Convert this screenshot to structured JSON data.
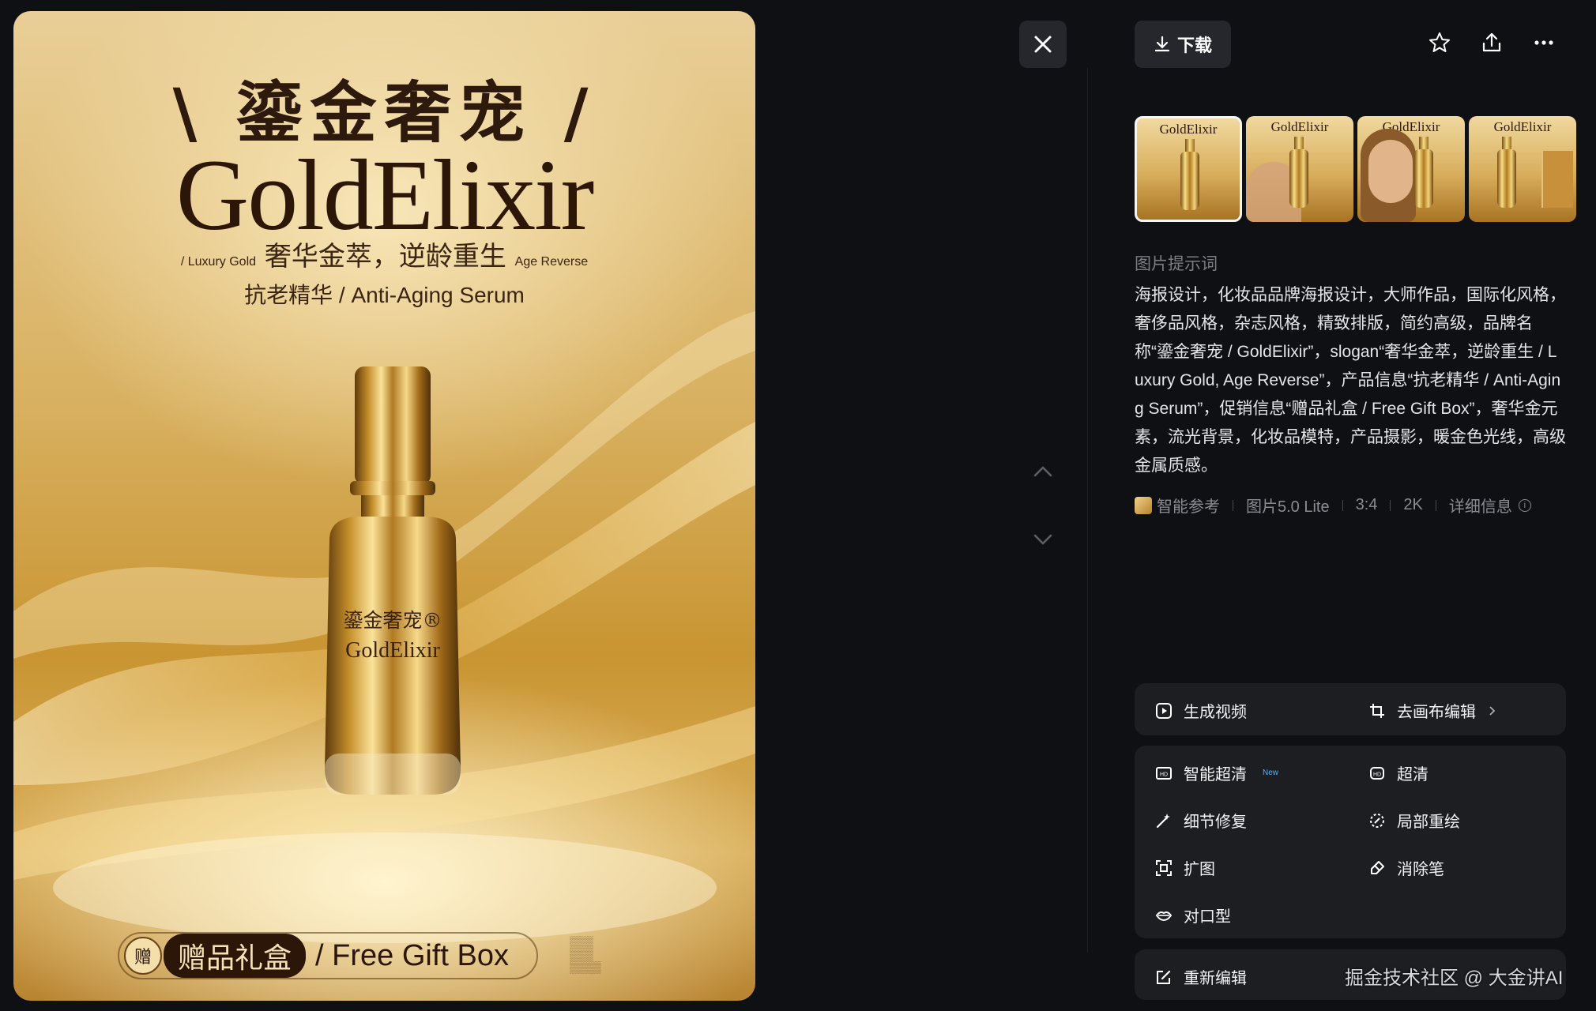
{
  "poster": {
    "title_cn": "\\ 鎏金奢宠 /",
    "title_en": "GoldElixir",
    "slogan_prefix": "/ Luxury Gold",
    "slogan_cn": "奢华金萃，逆龄重生",
    "slogan_suffix": "Age Reverse",
    "product": "抗老精华 / Anti-Aging Serum",
    "bottle_cn": "鎏金奢宠®",
    "bottle_en": "GoldElixir",
    "gift_badge": "赠",
    "gift_cn": "赠品礼盒",
    "gift_en": "/ Free Gift Box"
  },
  "toolbar": {
    "download_label": "下载",
    "icons": [
      "close-icon",
      "chevron-up-icon",
      "chevron-down-icon",
      "star-icon",
      "share-icon",
      "more-icon"
    ]
  },
  "thumbnails": [
    {
      "title": "GoldElixir",
      "active": true
    },
    {
      "title": "GoldElixir",
      "active": false
    },
    {
      "title": "GoldElixir",
      "active": false
    },
    {
      "title": "GoldElixir",
      "active": false
    }
  ],
  "prompt_section": {
    "label": "图片提示词",
    "text": "海报设计，化妆品品牌海报设计，大师作品，国际化风格，奢侈品风格，杂志风格，精致排版，简约高级，品牌名称“鎏金奢宠 / GoldElixir”，slogan“奢华金萃，逆龄重生 / Luxury Gold, Age Reverse”，产品信息“抗老精华 / Anti-Aging Serum”，促销信息“赠品礼盒 / Free Gift Box”，奢华金元素，流光背景，化妆品模特，产品摄影，暖金色光线，高级金属质感。"
  },
  "meta": {
    "reference": "智能参考",
    "model": "图片5.0 Lite",
    "ratio": "3:4",
    "resolution": "2K",
    "details": "详细信息"
  },
  "actions": {
    "generate_video": "生成视频",
    "canvas_edit": "去画布编辑",
    "smart_upscale": "智能超清",
    "new_badge": "New",
    "upscale": "超清",
    "detail_repair": "细节修复",
    "partial_redraw": "局部重绘",
    "expand": "扩图",
    "eraser": "消除笔",
    "lip_sync": "对口型",
    "re_edit": "重新编辑"
  },
  "watermark": "掘金技术社区 @ 大金讲AI"
}
